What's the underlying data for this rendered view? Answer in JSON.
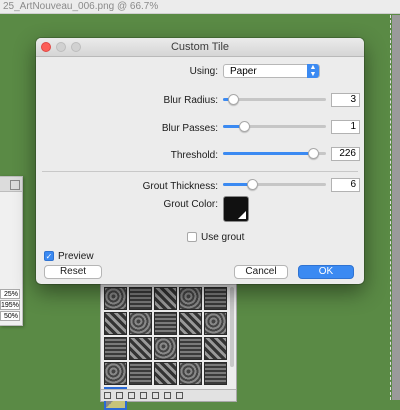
{
  "window": {
    "title": "25_ArtNouveau_006.png @ 66.7%"
  },
  "left_panel": {
    "values": [
      "25%",
      "195%",
      "50%"
    ]
  },
  "dialog": {
    "title": "Custom Tile",
    "using": {
      "label": "Using:",
      "value": "Paper"
    },
    "blur_radius": {
      "label": "Blur Radius:",
      "value": "3",
      "level": 0.1
    },
    "blur_passes": {
      "label": "Blur Passes:",
      "value": "1",
      "level": 0.2
    },
    "threshold": {
      "label": "Threshold:",
      "value": "226",
      "level": 0.87
    },
    "grout_thickness": {
      "label": "Grout Thickness:",
      "value": "6",
      "level": 0.28
    },
    "grout_color": {
      "label": "Grout Color:",
      "color": "#111111"
    },
    "use_grout": {
      "label": "Use grout",
      "checked": false
    },
    "preview": {
      "label": "Preview",
      "checked": true
    },
    "reset_label": "Reset",
    "cancel_label": "Cancel",
    "ok_label": "OK"
  },
  "colors": {
    "accent": "#3b8af2",
    "canvas": "#5a8a45"
  }
}
